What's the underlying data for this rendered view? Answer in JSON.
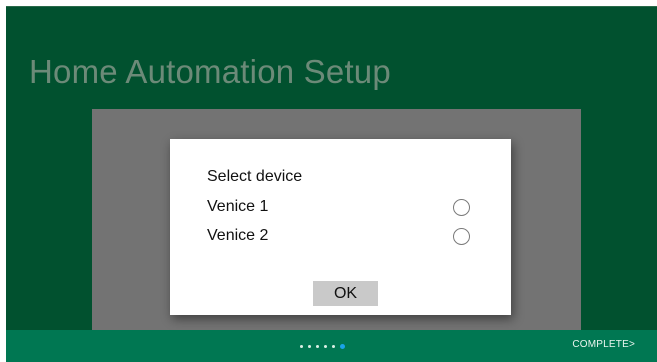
{
  "page": {
    "title": "Home Automation Setup"
  },
  "dialog": {
    "title": "Select device",
    "options": [
      {
        "label": "Venice 1",
        "selected": false
      },
      {
        "label": "Venice 2",
        "selected": false
      }
    ],
    "ok_label": "OK"
  },
  "footer": {
    "pager": {
      "total": 6,
      "current": 6
    },
    "complete_label": "COMPLETE>"
  },
  "colors": {
    "background": "#01512f",
    "footer": "#007752",
    "active_dot": "#1aa3e8",
    "overlay": "#737373"
  }
}
